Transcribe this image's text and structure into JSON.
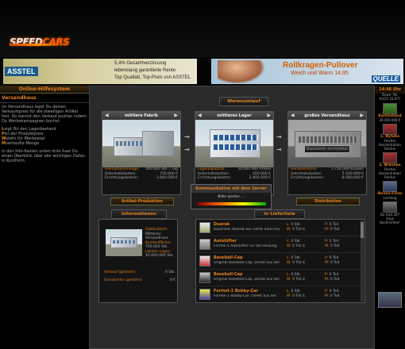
{
  "app": {
    "logo_part1": "SPEED",
    "logo_part2": "CARS"
  },
  "ads": {
    "bank_logo": "ASSTEL",
    "bank_lines": [
      "5,4% Gesamtverzinsung",
      "lebenslang garantierte Rente",
      "Top Qualität, Top-Preis von ASSTEL"
    ],
    "shop_title": "Rollkragen-Pullover",
    "shop_subtitle": "Weich und Warm",
    "shop_price": "14,95",
    "shop_brand": "QUELLE"
  },
  "help": {
    "header": "Online-Hilfesystem",
    "section": "Versandhaus",
    "intro": "Im Versandhaus legst Du deinen Verkaufspreis für die jeweiligen Artikel fest. Du kannst den Verkauf pushen indem Du Werbekampagnen buchst.",
    "items": [
      {
        "letter": "L",
        "text": "eigt Dir den Lagerbestand"
      },
      {
        "letter": "P",
        "text": "ist der Produktpreis"
      },
      {
        "letter": "W",
        "text": "steht für Werbeetat"
      },
      {
        "letter": "M",
        "text": "verkaufte Menge"
      }
    ],
    "outro": "In den Info-Kasten unten links hast Du einen Überblick über alle wichtigen Daten in Kurzform."
  },
  "right": {
    "time": "14:48 Uhr",
    "team_label": "Team: Nr.",
    "team_value": "6315 (0.67)",
    "cash_label": "Kontostand",
    "cash_value": "28.000.000 €",
    "player1": "1. Rytoka",
    "player1_sub": [
      "Frecher",
      "Konzentration",
      "Frecher"
    ],
    "player2": "2. Brauseo",
    "player2_sub": [
      "Frecher",
      "Konzentration",
      "Frecher"
    ],
    "news_title": "Boxen-Crew",
    "news_sub": "Lecheng",
    "msg_count_text": "Du hast 347 neue Nachrichten!"
  },
  "flow": {
    "title": "Warenumlauf",
    "factory": {
      "title": "mittlere Fabrik",
      "rows": [
        [
          "Produktionsmenge:",
          "400.000 Stk. / Tag"
        ],
        [
          "Unterhaltskosten:",
          "750.000 €"
        ],
        [
          "Errichtungskosten:",
          "3.800.000 €"
        ]
      ],
      "button": "Artikel-Produktion"
    },
    "warehouse": {
      "title": "mittleres Lager",
      "rows": [
        [
          "Lagerkapazität:",
          "50.000.000 Artikel"
        ],
        [
          "Unterhaltskosten:",
          "450.000 €"
        ],
        [
          "Errichtungskosten:",
          "2.400.000 €"
        ]
      ]
    },
    "shop": {
      "title": "großes Versandhaus",
      "rows": [
        [
          "Handelsfläche:",
          "1.750.000 Kunden"
        ],
        [
          "Unterhaltskosten:",
          "5.500.000 €"
        ],
        [
          "Errichtungskosten:",
          "8.000.000 €"
        ]
      ],
      "overlay": "Bauwerk errichten",
      "button": "Distribution"
    }
  },
  "dialog": {
    "title": "Kommunikation mit dem Server",
    "message": "Bitte warten ..."
  },
  "info": {
    "title": "Informationen",
    "label1": "Gebäudeart:",
    "value1": "Mittleres Versandhaus",
    "label2": "Kundenfläche:",
    "value2": "700.000 Stk.",
    "label3": "Lokaler Lager:",
    "value3": "10.000.000 Stk.",
    "line1_label": "Verkauf (gestern)",
    "line1_value": "0 Stk.",
    "line2_label": "Einnahmen (gestern)",
    "line2_value": "0 €"
  },
  "products": {
    "title": "In Lieferliste",
    "items": [
      {
        "name": "Duarak",
        "desc": "Rauchfrei-Akarob aus 100% Sonn'Ina",
        "L": "0 Stk",
        "P": "0 Tsd",
        "W": "0 Tsd $",
        "M": "0 Tsd"
      },
      {
        "name": "Autolüfter",
        "desc": "Formel-1 Autolüfter für die Heizung",
        "L": "0 Stk",
        "P": "0 Tsd",
        "W": "0 Tsd $",
        "M": "0 Tsd"
      },
      {
        "name": "Baseball-Cap",
        "desc": "Original Baseball-Cap. Direkt aus der",
        "L": "0 Stk",
        "P": "0 Tsd",
        "W": "0 Tsd $",
        "M": "0 Tsd"
      },
      {
        "name": "Baseball-Cap",
        "desc": "Original Baseball-Cap. Direkt aus der",
        "L": "0 Stk",
        "P": "0 Tsd",
        "W": "0 Tsd $",
        "M": "0 Tsd"
      },
      {
        "name": "Formel-1 Bobby-Car",
        "desc": "Formel-1 Bobby-Car. Direkt aus der",
        "L": "0 Stk",
        "P": "0 Tsd",
        "W": "0 Tsd $",
        "M": "0 Tsd"
      }
    ]
  },
  "colors": {
    "accent": "#e08020",
    "panel": "#1c1c1c"
  }
}
